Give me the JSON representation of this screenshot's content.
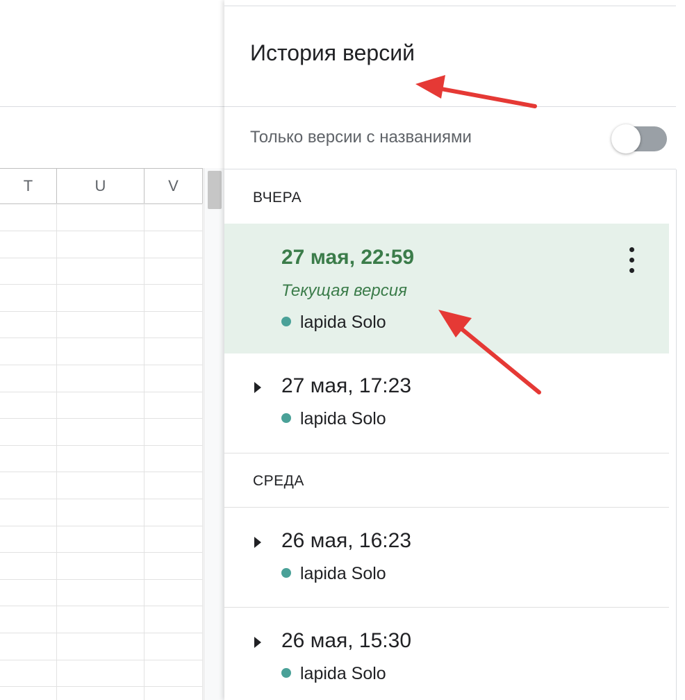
{
  "sheet": {
    "columns": [
      "T",
      "U",
      "V"
    ]
  },
  "panel": {
    "title": "История версий",
    "filter_label": "Только версии с названиями",
    "filter_toggle_on": false,
    "sections": [
      {
        "label": "ВЧЕРА",
        "versions": [
          {
            "time": "27 мая, 22:59",
            "subtitle": "Текущая версия",
            "author": "lapida Solo",
            "selected": true
          },
          {
            "time": "27 мая, 17:23",
            "author": "lapida Solo",
            "selected": false
          }
        ]
      },
      {
        "label": "СРЕДА",
        "versions": [
          {
            "time": "26 мая, 16:23",
            "author": "lapida Solo",
            "selected": false
          },
          {
            "time": "26 мая, 15:30",
            "author": "lapida Solo",
            "selected": false
          }
        ]
      }
    ]
  },
  "colors": {
    "selected_bg": "#e6f1ea",
    "current_green": "#3b7c4a",
    "author_dot": "#4aa198",
    "annotation_arrow": "#e53935"
  }
}
